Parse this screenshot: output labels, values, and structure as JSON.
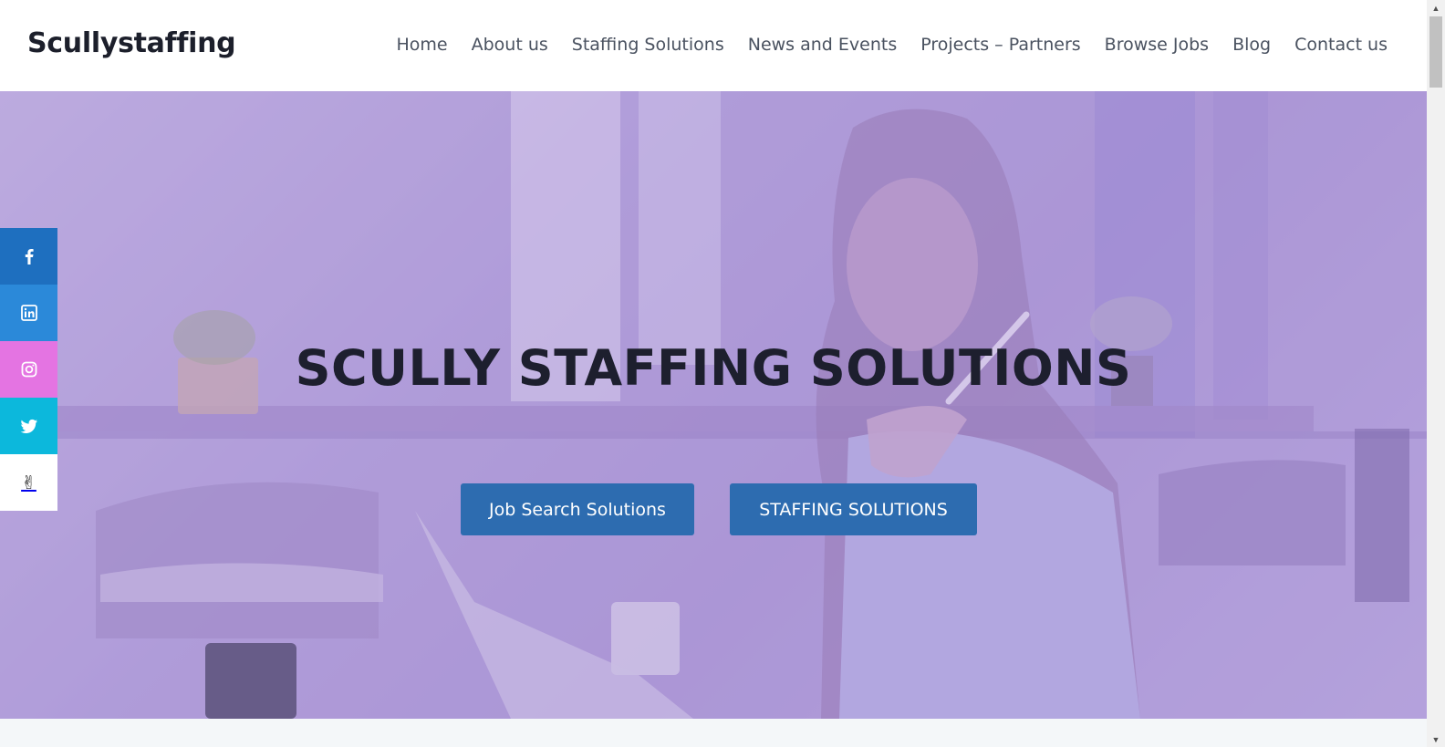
{
  "site": {
    "logo": "Scullystaffing"
  },
  "nav": [
    {
      "label": "Home"
    },
    {
      "label": "About us"
    },
    {
      "label": "Staffing Solutions"
    },
    {
      "label": "News and Events"
    },
    {
      "label": "Projects – Partners"
    },
    {
      "label": "Browse Jobs"
    },
    {
      "label": "Blog"
    },
    {
      "label": "Contact us"
    }
  ],
  "hero": {
    "title": "SCULLY STAFFING SOLUTIONS",
    "buttons": {
      "job_search": "Job Search Solutions",
      "staffing": "STAFFING SOLUTIONS"
    }
  },
  "social": [
    {
      "icon": "facebook-icon",
      "color": "#1e6fbf"
    },
    {
      "icon": "linkedin-icon",
      "color": "#2b89d9"
    },
    {
      "icon": "instagram-icon",
      "color": "#e474e2"
    },
    {
      "icon": "twitter-icon",
      "color": "#0cb8dc"
    },
    {
      "icon": "peace-hand-icon",
      "color": "#ffffff"
    }
  ],
  "colors": {
    "button": "#2d6cb0",
    "hero_overlay": "#a48ccf",
    "title": "#1d1f2e"
  }
}
